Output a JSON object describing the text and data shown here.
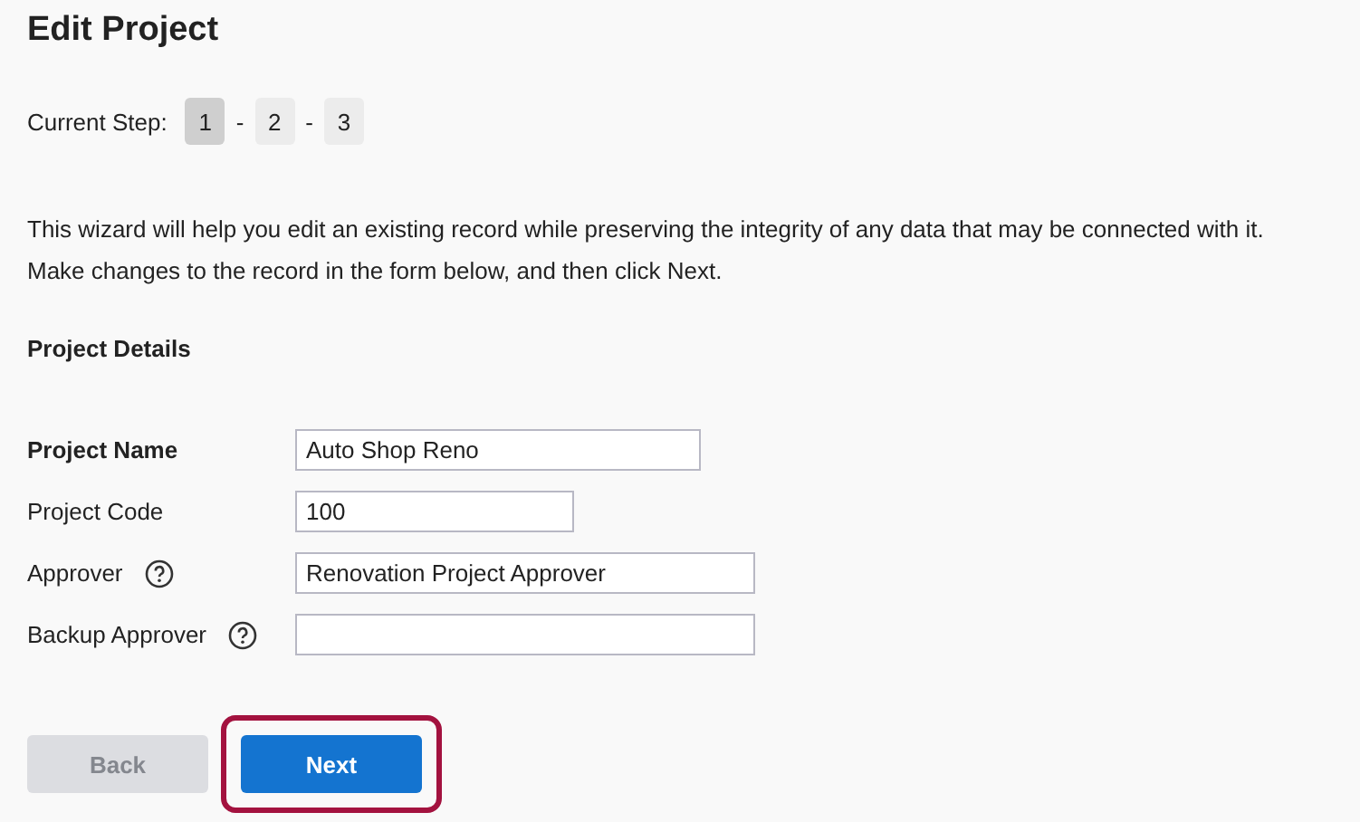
{
  "title": "Edit Project",
  "steps": {
    "label": "Current Step:",
    "items": [
      {
        "label": "1",
        "selected": true
      },
      {
        "label": "2",
        "selected": false
      },
      {
        "label": "3",
        "selected": false
      }
    ],
    "separator": "-"
  },
  "intro": [
    "This wizard will help you edit an existing record while preserving the integrity of any data that may be connected with it.",
    "Make changes to the record in the form below, and then click Next."
  ],
  "section_title": "Project Details",
  "fields": [
    {
      "label": "Project Name",
      "required": true,
      "help": false,
      "value": "Auto Shop Reno"
    },
    {
      "label": "Project Code",
      "required": false,
      "help": false,
      "value": "100"
    },
    {
      "label": "Approver",
      "required": false,
      "help": true,
      "value": "Renovation Project Approver"
    },
    {
      "label": "Backup Approver",
      "required": false,
      "help": true
    }
  ],
  "buttons": [
    {
      "label": "Back",
      "disabled": true,
      "primary": false,
      "highlighted": false
    },
    {
      "label": "Next",
      "disabled": false,
      "primary": true,
      "highlighted": true
    }
  ]
}
